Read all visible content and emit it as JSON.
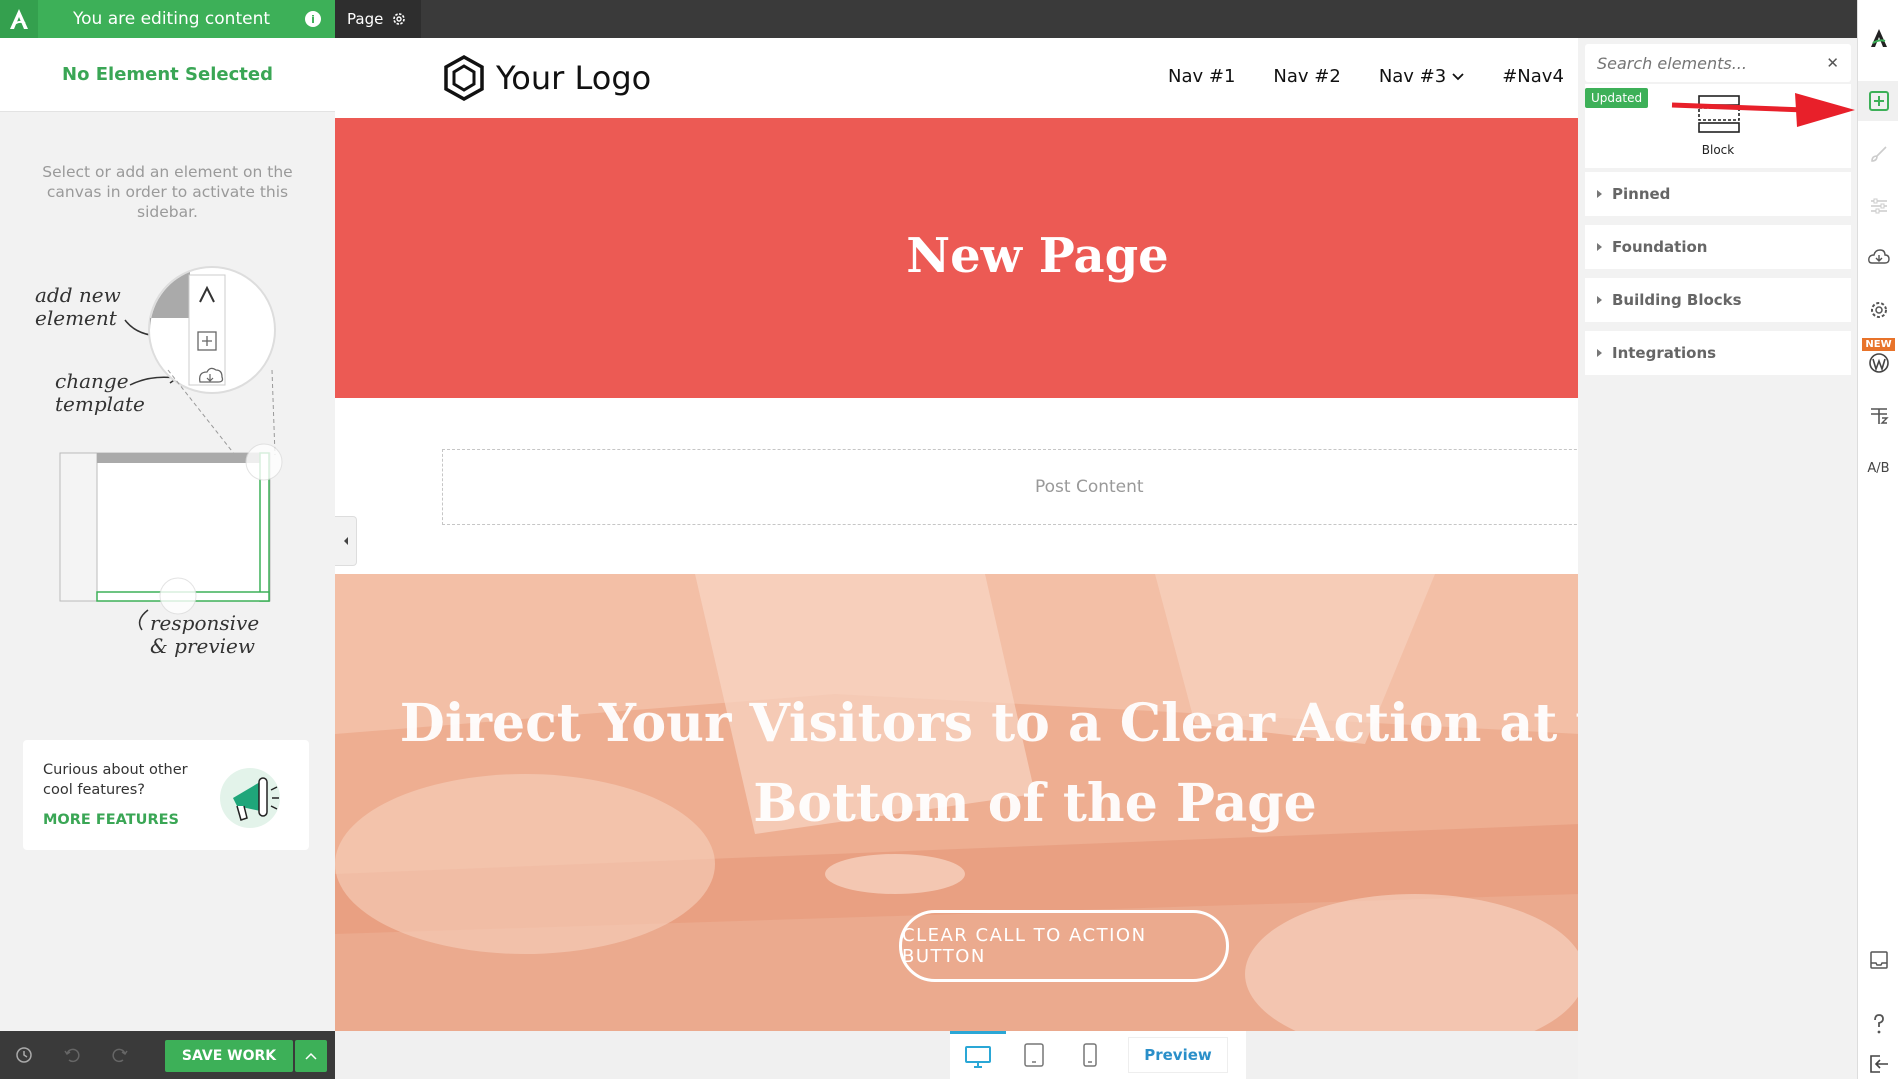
{
  "top": {
    "editing_label": "You are editing content",
    "page_tab_label": "Page"
  },
  "sidebar": {
    "selection_status": "No Element Selected",
    "hint": "Select or add an element on the canvas in order to activate this sidebar.",
    "illustration": {
      "add_new_element": "add new element",
      "change_template": "change template",
      "responsive_preview": "responsive & preview"
    },
    "features_card": {
      "text": "Curious about other cool features?",
      "link": "MORE FEATURES"
    },
    "save_label": "SAVE WORK"
  },
  "site": {
    "logo_text": "Your Logo",
    "nav": [
      "Nav #1",
      "Nav #2",
      "Nav #3",
      "#Nav4"
    ],
    "hero_title": "New Page",
    "post_content_label": "Post Content",
    "cta_title": "Direct Your Visitors to a Clear Action at the Bottom of the Page",
    "cta_button": "CLEAR CALL TO ACTION BUTTON"
  },
  "elements_panel": {
    "search_placeholder": "Search elements...",
    "updated_badge": "Updated",
    "block_label": "Block",
    "sections": [
      "Pinned",
      "Foundation",
      "Building Blocks",
      "Integrations"
    ]
  },
  "rail": {
    "new_badge": "NEW",
    "ab_label": "A/B"
  },
  "device_bar": {
    "preview_label": "Preview"
  },
  "colors": {
    "brand_green": "#3db058",
    "hero_red": "#ec5a54",
    "dark_bar": "#3a3a3a",
    "arrow_red": "#e8202a"
  }
}
